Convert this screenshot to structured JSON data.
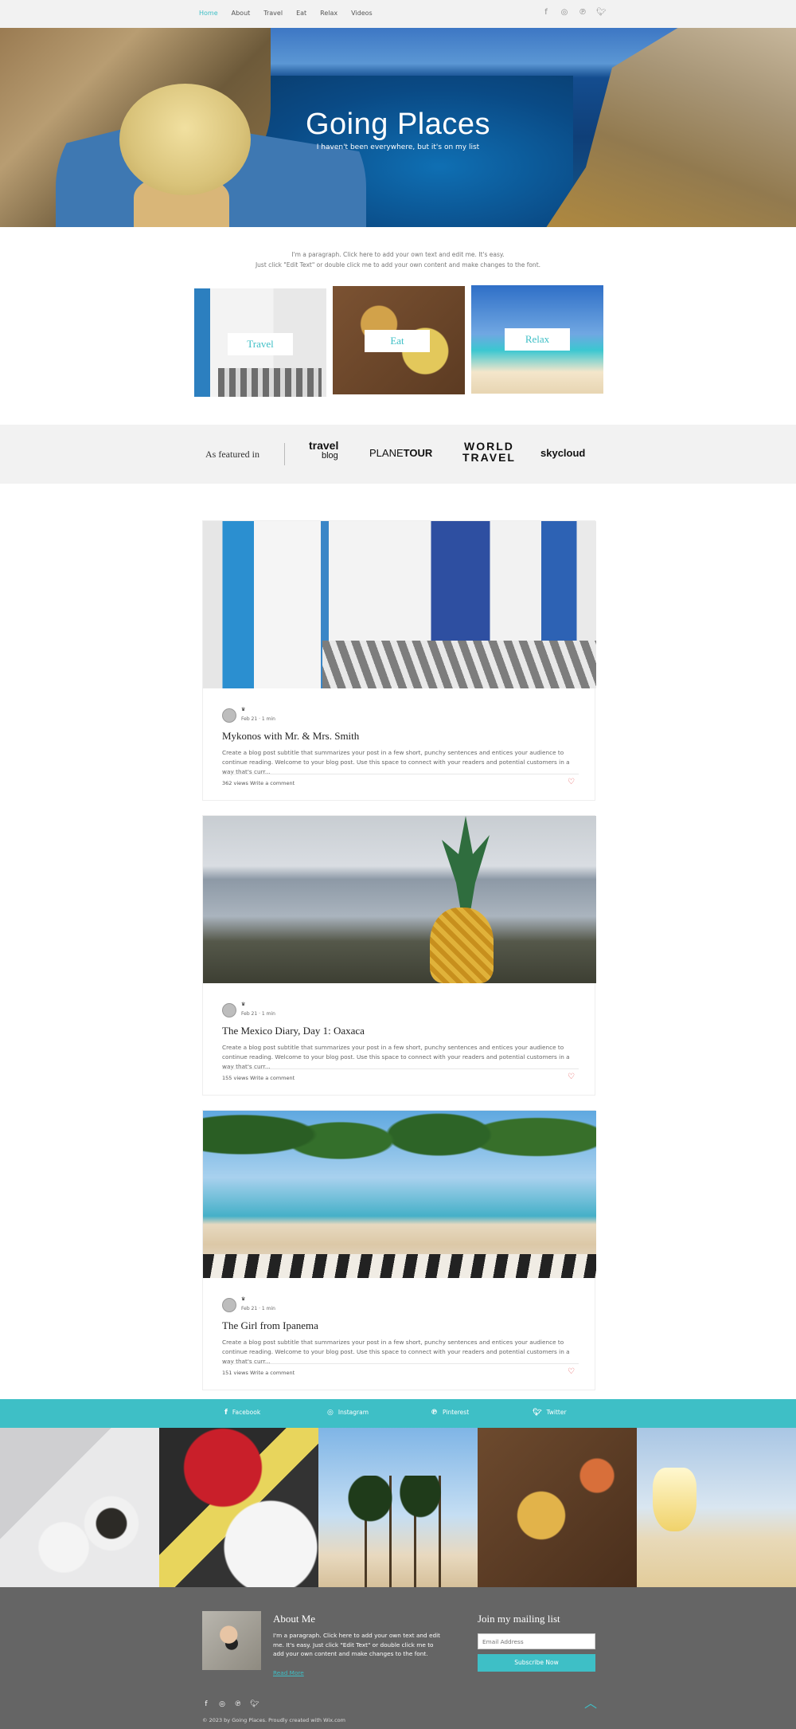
{
  "nav": {
    "items": [
      "Home",
      "About",
      "Travel",
      "Eat",
      "Relax",
      "Videos"
    ],
    "active": "Home"
  },
  "social_icons": [
    "facebook-icon",
    "instagram-icon",
    "pinterest-icon",
    "twitter-icon"
  ],
  "hero": {
    "title": "Going Places",
    "subtitle": "I haven't been everywhere, but it's on my list"
  },
  "intro": {
    "line1": "I'm a paragraph. Click here to add your own text and edit me. It's easy.",
    "line2": "Just click \"Edit Text\" or double click me to add your own content and make changes to the font."
  },
  "categories": [
    "Travel",
    "Eat",
    "Relax"
  ],
  "featured": {
    "label": "As featured in",
    "logos": {
      "travel_blog_1": "travel",
      "travel_blog_2": "blog",
      "planetour_1": "PLANE",
      "planetour_2": "TOUR",
      "world_1": "WORLD",
      "world_2": "TRAVEL",
      "skycloud": "skycloud"
    }
  },
  "posts": [
    {
      "title": "Mykonos with Mr. & Mrs. Smith",
      "meta": "Feb 21  ·  1 min",
      "excerpt": "Create a blog post subtitle that summarizes your post in a few short, punchy sentences and entices your audience to continue reading. Welcome to your blog post. Use this space to connect with your readers and potential customers in a way that's curr...",
      "views": "362 views",
      "comment": "Write a comment"
    },
    {
      "title": "The Mexico Diary, Day 1: Oaxaca",
      "meta": "Feb 21  ·  1 min",
      "excerpt": "Create a blog post subtitle that summarizes your post in a few short, punchy sentences and entices your audience to continue reading. Welcome to your blog post. Use this space to connect with your readers and potential customers in a way that's curr...",
      "views": "155 views",
      "comment": "Write a comment"
    },
    {
      "title": "The Girl from Ipanema",
      "meta": "Feb 21  ·  1 min",
      "excerpt": "Create a blog post subtitle that summarizes your post in a few short, punchy sentences and entices your audience to continue reading. Welcome to your blog post. Use this space to connect with your readers and potential customers in a way that's curr...",
      "views": "151 views",
      "comment": "Write a comment"
    }
  ],
  "social_strip": [
    "Facebook",
    "Instagram",
    "Pinterest",
    "Twitter"
  ],
  "footer": {
    "about_heading": "About Me",
    "about_text": "I'm a paragraph. Click here to add your own text and edit me. It's easy. Just click \"Edit Text\" or double click me to add your own content and make changes to the font.",
    "read_more": "Read More",
    "mailing_heading": "Join my mailing list",
    "email_placeholder": "Email Address",
    "subscribe": "Subscribe Now",
    "copyright": "© 2023 by Going Places. Proudly created with Wix.com"
  },
  "colors": {
    "accent": "#3ebfc6",
    "footer_bg": "#656565",
    "band_bg": "#f2f2f2",
    "heart": "#e34d4d"
  }
}
